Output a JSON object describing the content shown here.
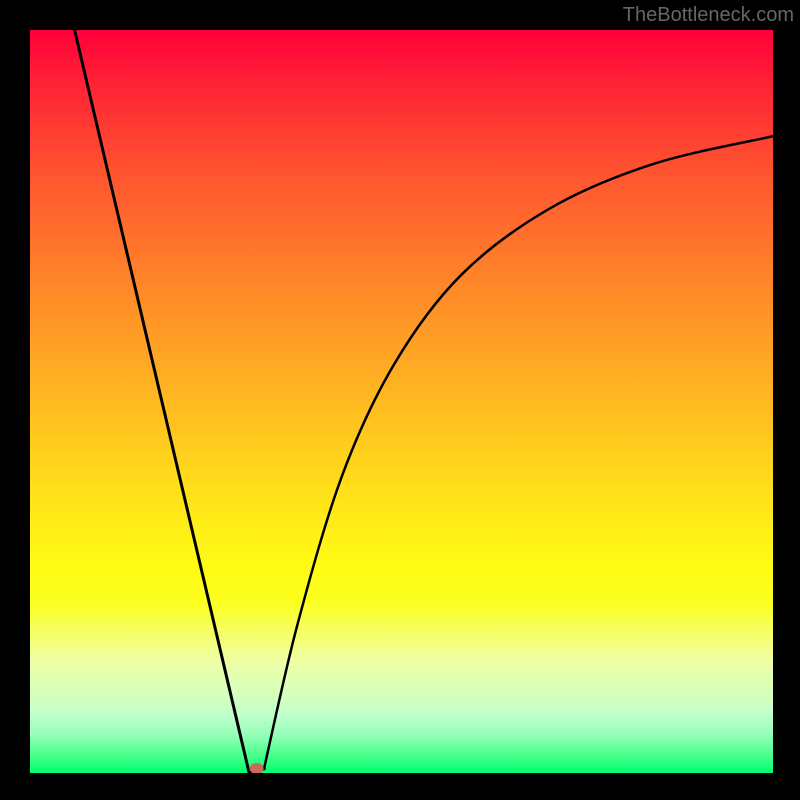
{
  "watermark": "TheBottleneck.com",
  "chart_data": {
    "type": "line",
    "title": "",
    "xlabel": "",
    "ylabel": "",
    "xlim": [
      0,
      1
    ],
    "ylim": [
      0,
      1
    ],
    "minimum_point": {
      "x": 0.305,
      "y": 0.006
    },
    "series": [
      {
        "name": "left-segment",
        "x": [
          0.06,
          0.295
        ],
        "y": [
          1.0,
          0.0
        ],
        "style": "line"
      },
      {
        "name": "flat-bottom",
        "x": [
          0.295,
          0.315
        ],
        "y": [
          0.0,
          0.006
        ],
        "style": "line"
      },
      {
        "name": "right-curve",
        "x": [
          0.315,
          0.36,
          0.42,
          0.49,
          0.58,
          0.7,
          0.84,
          1.0
        ],
        "y": [
          0.006,
          0.2,
          0.4,
          0.55,
          0.67,
          0.76,
          0.82,
          0.857
        ],
        "style": "curve"
      },
      {
        "name": "marker",
        "x": [
          0.305
        ],
        "y": [
          0.006
        ],
        "style": "point",
        "color": "#c96a5a"
      }
    ],
    "background_gradient": {
      "top": "#ff0039",
      "mid_upper": "#ff8928",
      "mid": "#ffe01a",
      "mid_lower": "#eeffa7",
      "bottom": "#00ff72"
    },
    "frame": "black"
  }
}
